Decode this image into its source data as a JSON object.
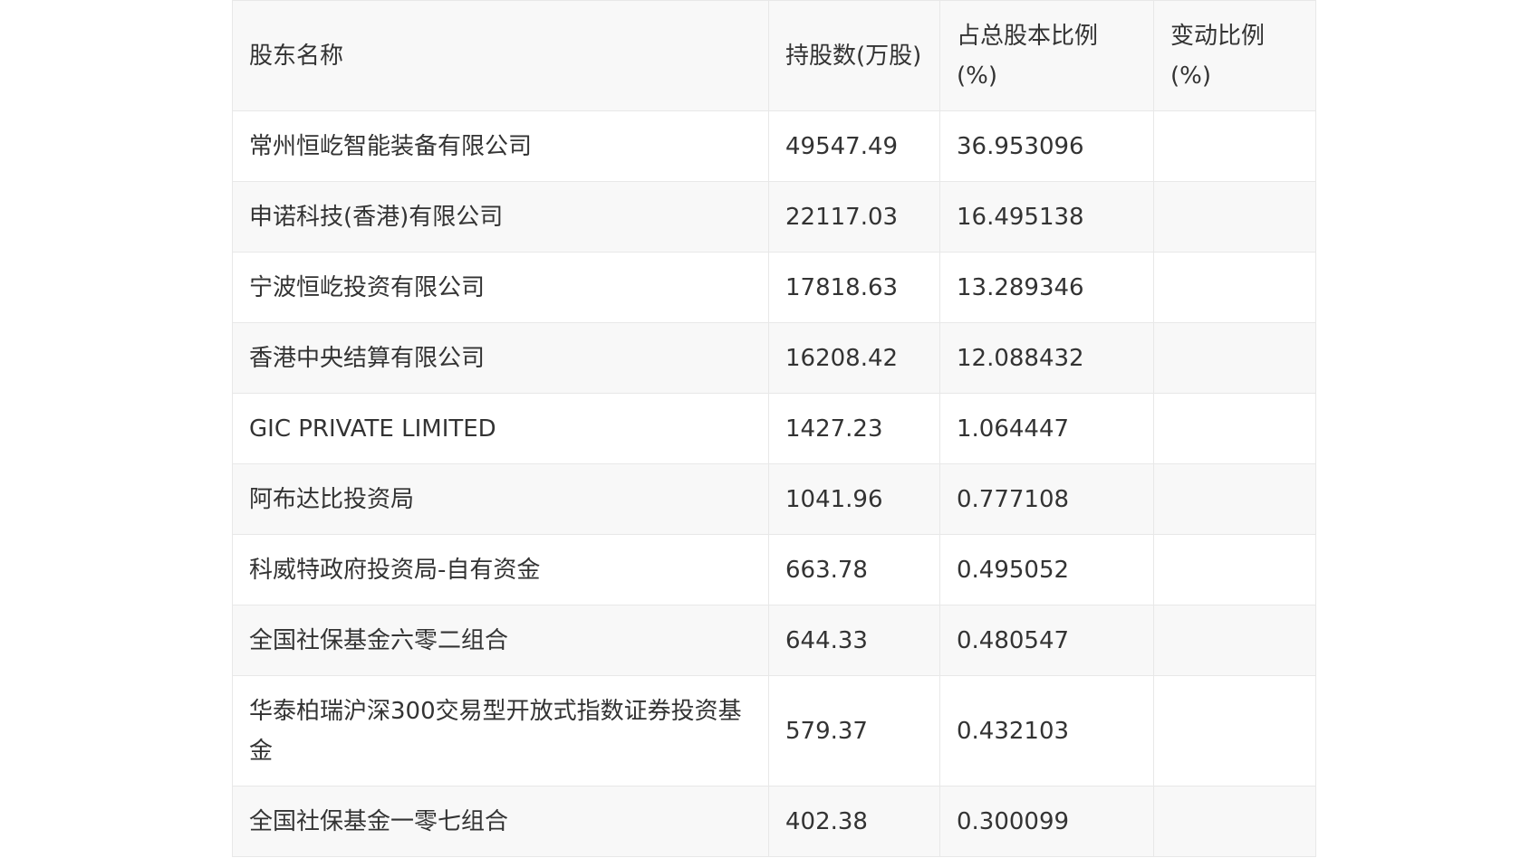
{
  "table": {
    "headers": [
      "股东名称",
      "持股数(万股)",
      "占总股本比例(%)",
      "变动比例(%)"
    ],
    "rows": [
      [
        "常州恒屹智能装备有限公司",
        "49547.49",
        "36.953096",
        ""
      ],
      [
        "申诺科技(香港)有限公司",
        "22117.03",
        "16.495138",
        ""
      ],
      [
        "宁波恒屹投资有限公司",
        "17818.63",
        "13.289346",
        ""
      ],
      [
        "香港中央结算有限公司",
        "16208.42",
        "12.088432",
        ""
      ],
      [
        "GIC PRIVATE LIMITED",
        "1427.23",
        "1.064447",
        ""
      ],
      [
        "阿布达比投资局",
        "1041.96",
        "0.777108",
        ""
      ],
      [
        "科威特政府投资局-自有资金",
        "663.78",
        "0.495052",
        ""
      ],
      [
        "全国社保基金六零二组合",
        "644.33",
        "0.480547",
        ""
      ],
      [
        "华泰柏瑞沪深300交易型开放式指数证券投资基金",
        "579.37",
        "0.432103",
        ""
      ],
      [
        "全国社保基金一零七组合",
        "402.38",
        "0.300099",
        ""
      ]
    ]
  }
}
